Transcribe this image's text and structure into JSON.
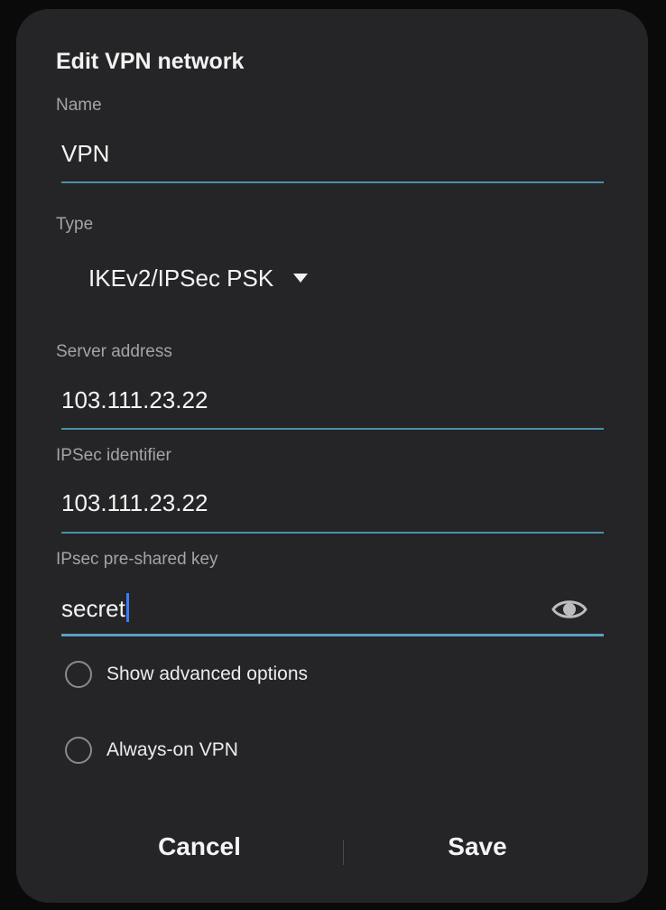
{
  "dialog": {
    "title": "Edit VPN network"
  },
  "fields": {
    "name": {
      "label": "Name",
      "value": "VPN"
    },
    "type": {
      "label": "Type",
      "value": "IKEv2/IPSec PSK"
    },
    "server_address": {
      "label": "Server address",
      "value": "103.111.23.22"
    },
    "ipsec_identifier": {
      "label": "IPSec identifier",
      "value": "103.111.23.22"
    },
    "pre_shared_key": {
      "label": "IPsec pre-shared key",
      "value": "secret"
    }
  },
  "options": {
    "show_advanced": {
      "label": "Show advanced options",
      "checked": false
    },
    "always_on": {
      "label": "Always-on VPN",
      "checked": false
    }
  },
  "buttons": {
    "cancel": "Cancel",
    "save": "Save"
  },
  "icons": {
    "type_dropdown": "caret-down-icon",
    "password_toggle": "eye-icon"
  },
  "colors": {
    "dialog_background": "#252527",
    "underline_accent": "#4b90a8",
    "cursor": "#3b7bff"
  }
}
